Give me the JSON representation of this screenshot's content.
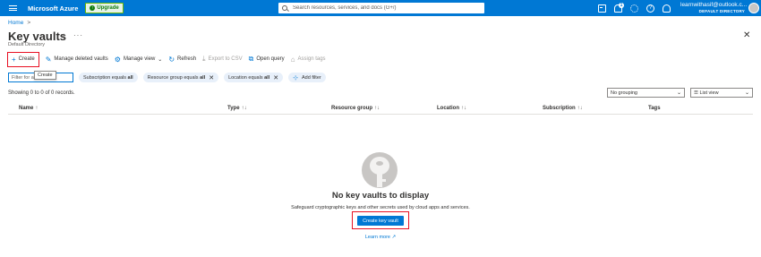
{
  "topbar": {
    "brand": "Microsoft Azure",
    "upgrade_label": "Upgrade",
    "search_placeholder": "Search resources, services, and docs (G+/)",
    "notification_count": "1",
    "account_email": "learnwithasif@outlook.c...",
    "account_directory": "DEFAULT DIRECTORY",
    "icons": [
      "cloud-shell-icon",
      "notifications-icon",
      "settings-icon",
      "help-icon",
      "feedback-icon"
    ]
  },
  "breadcrumb": {
    "home": "Home",
    "separator": ">"
  },
  "page": {
    "title": "Key vaults",
    "subtitle": "Default Directory"
  },
  "commands": {
    "create": "Create",
    "manage_deleted": "Manage deleted vaults",
    "manage_view": "Manage view",
    "refresh": "Refresh",
    "export_csv": "Export to CSV",
    "open_query": "Open query",
    "assign_tags": "Assign tags",
    "tooltip": "Create"
  },
  "filters": {
    "input_placeholder": "Filter for any field...",
    "pills": [
      {
        "label": "Subscription equals ",
        "value": "all"
      },
      {
        "label": "Resource group equals ",
        "value": "all"
      },
      {
        "label": "Location equals ",
        "value": "all"
      }
    ],
    "add_filter": "Add filter"
  },
  "records": "Showing 0 to 0 of 0 records.",
  "grouping": "No grouping",
  "view": "List view",
  "columns": [
    "Name",
    "Type",
    "Resource group",
    "Location",
    "Subscription",
    "Tags"
  ],
  "sort_glyph": "↑↓",
  "empty_state": {
    "title": "No key vaults to display",
    "description": "Safeguard cryptographic keys and other secrets used by cloud apps and services.",
    "button": "Create key vault",
    "link": "Learn more"
  },
  "colors": {
    "accent": "#0078d4",
    "highlight": "#e81123"
  }
}
